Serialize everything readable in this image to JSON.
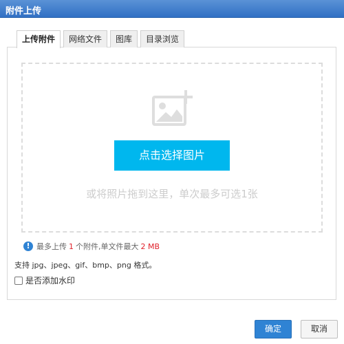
{
  "window": {
    "title": "附件上传"
  },
  "tabs": [
    {
      "label": "上传附件",
      "active": true
    },
    {
      "label": "网络文件",
      "active": false
    },
    {
      "label": "图库",
      "active": false
    },
    {
      "label": "目录浏览",
      "active": false
    }
  ],
  "dropzone": {
    "icon": "image-add-icon",
    "choose_button": "点击选择图片",
    "hint": "或将照片拖到这里，单次最多可选1张"
  },
  "info": {
    "icon": "info-icon",
    "prefix": "最多上传",
    "max_count": "1",
    "middle": "个附件,单文件最大",
    "max_size": "2 MB"
  },
  "support_text": "支持 jpg、jpeg、gif、bmp、png 格式。",
  "watermark": {
    "label": "是否添加水印",
    "checked": false
  },
  "buttons": {
    "ok": "确定",
    "cancel": "取消"
  },
  "colors": {
    "accent": "#00b7ee",
    "primary": "#2f83d4",
    "highlight": "#e0202a"
  }
}
